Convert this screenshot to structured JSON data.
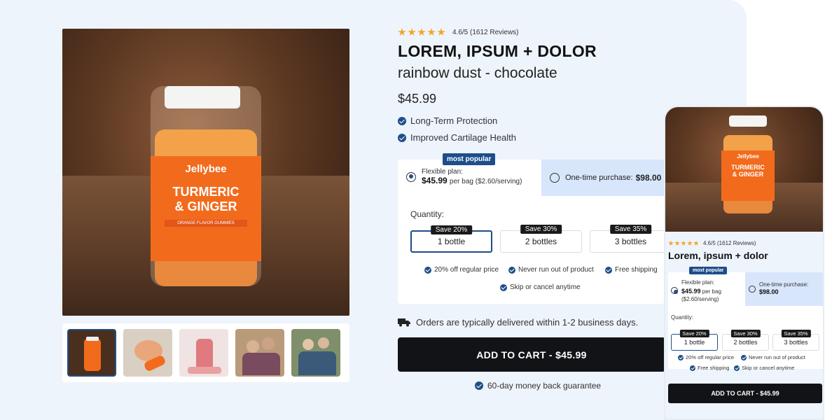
{
  "rating": {
    "stars": 5,
    "text": "4.6/5 (1612 Reviews)"
  },
  "product": {
    "title": "LOREM, IPSUM + DOLOR",
    "subtitle": "rainbow dust - chocolate",
    "price": "$45.99",
    "brand": "Jellybee",
    "label_line1": "TURMERIC",
    "label_line2": "& GINGER",
    "label_sub": "ORANGE FLAVOR GUMMIES"
  },
  "features": [
    "Long-Term Protection",
    "Improved Cartilage Health"
  ],
  "plans": {
    "badge": "most popular",
    "flexible_label": "Flexible plan:",
    "flexible_price": "$45.99",
    "flexible_detail": "per bag ($2.60/serving)",
    "onetime_label": "One-time purchase:",
    "onetime_price": "$98.00"
  },
  "quantity": {
    "label": "Quantity:",
    "options": [
      {
        "save": "Save 20%",
        "label": "1 bottle",
        "selected": true
      },
      {
        "save": "Save 30%",
        "label": "2 bottles",
        "selected": false
      },
      {
        "save": "Save 35%",
        "label": "3 bottles",
        "selected": false
      }
    ]
  },
  "benefits": [
    "20% off regular price",
    "Never run out of product",
    "Free shipping",
    "Skip or cancel anytime"
  ],
  "delivery": "Orders are typically delivered within 1-2 business days.",
  "cart_button": "ADD TO CART - $45.99",
  "guarantee": "60-day money back guarantee",
  "mobile": {
    "rating": "4.6/5 (1612 Reviews)",
    "title": "Lorem, ipsum + dolor",
    "badge": "most popular",
    "flexible_label": "Flexible plan:",
    "flexible_price": "$45.99",
    "flexible_detail_1": "per bag",
    "flexible_detail_2": "($2.60/serving)",
    "onetime_label": "One-time purchase:",
    "onetime_price": "$98.00",
    "quantity_label": "Quantity:",
    "cart_button": "ADD TO CART - $45.99"
  },
  "colors": {
    "accent": "#1d4e89",
    "star": "#f5a524",
    "bottle_label": "#f26b1d",
    "cart": "#121316",
    "background": "#eef4fc"
  }
}
